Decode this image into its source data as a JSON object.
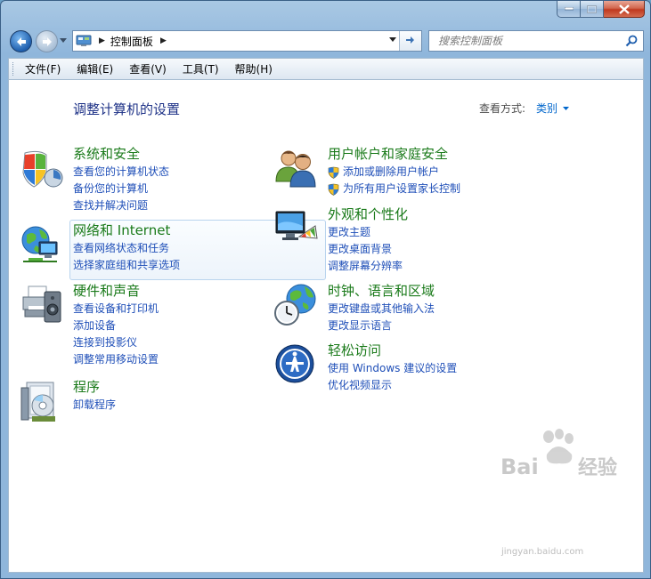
{
  "window": {
    "min_label": "minimize",
    "max_label": "maximize",
    "close_label": "close"
  },
  "address": {
    "crumb": "控制面板"
  },
  "search": {
    "placeholder": "搜索控制面板"
  },
  "menu": [
    "文件(F)",
    "编辑(E)",
    "查看(V)",
    "工具(T)",
    "帮助(H)"
  ],
  "page": {
    "title": "调整计算机的设置",
    "view_by_label": "查看方式:",
    "view_by_value": "类别"
  },
  "categories": {
    "system": {
      "title": "系统和安全",
      "links": [
        "查看您的计算机状态",
        "备份您的计算机",
        "查找并解决问题"
      ],
      "icon": "shield-icon"
    },
    "network": {
      "title": "网络和 Internet",
      "links": [
        "查看网络状态和任务",
        "选择家庭组和共享选项"
      ],
      "icon": "globe-network-icon"
    },
    "hardware": {
      "title": "硬件和声音",
      "links": [
        "查看设备和打印机",
        "添加设备",
        "连接到投影仪",
        "调整常用移动设置"
      ],
      "icon": "printer-icon"
    },
    "programs": {
      "title": "程序",
      "links": [
        "卸载程序"
      ],
      "icon": "programs-icon"
    },
    "users": {
      "title": "用户帐户和家庭安全",
      "links": [
        "添加或删除用户帐户",
        "为所有用户设置家长控制"
      ],
      "icon": "users-icon"
    },
    "appearance": {
      "title": "外观和个性化",
      "links": [
        "更改主题",
        "更改桌面背景",
        "调整屏幕分辨率"
      ],
      "icon": "monitor-palette-icon"
    },
    "clock": {
      "title": "时钟、语言和区域",
      "links": [
        "更改键盘或其他输入法",
        "更改显示语言"
      ],
      "icon": "clock-globe-icon"
    },
    "ease": {
      "title": "轻松访问",
      "links": [
        "使用 Windows 建议的设置",
        "优化视频显示"
      ],
      "icon": "ease-of-access-icon"
    }
  },
  "watermark": {
    "text": "jingyan.baidu.com"
  }
}
